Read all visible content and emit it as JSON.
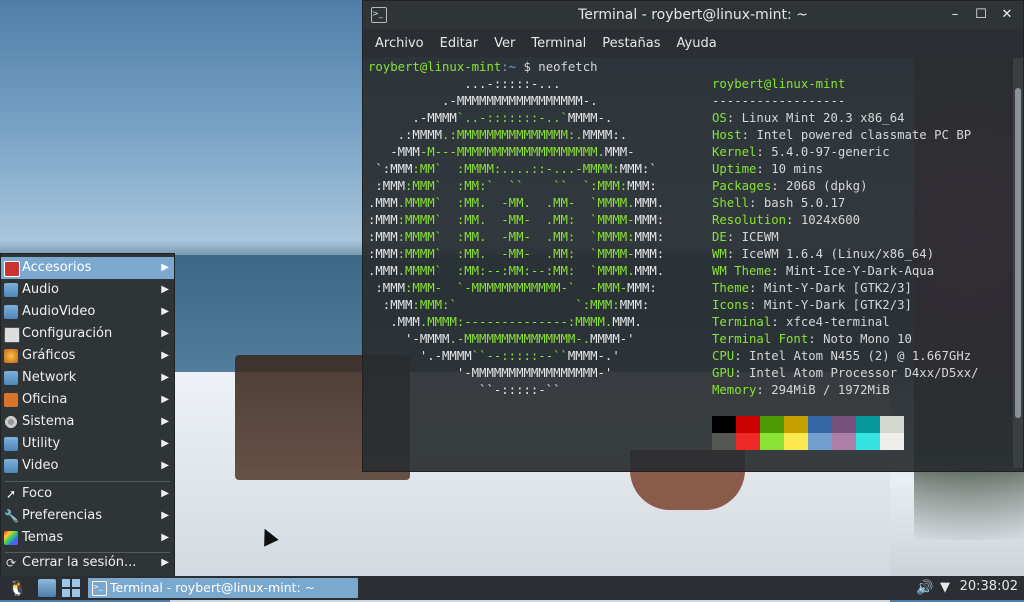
{
  "window": {
    "title": "Terminal - roybert@linux-mint: ~",
    "menu": [
      "Archivo",
      "Editar",
      "Ver",
      "Terminal",
      "Pestañas",
      "Ayuda"
    ]
  },
  "terminal": {
    "prompt_user": "roybert@linux-mint",
    "prompt_path": ":~",
    "prompt_cmd": "$ neofetch",
    "header": "roybert@linux-mint",
    "header_rule": "------------------",
    "info": [
      {
        "key": "OS",
        "value": "Linux Mint 20.3 x86_64"
      },
      {
        "key": "Host",
        "value": "Intel powered classmate PC BP"
      },
      {
        "key": "Kernel",
        "value": "5.4.0-97-generic"
      },
      {
        "key": "Uptime",
        "value": "10 mins"
      },
      {
        "key": "Packages",
        "value": "2068 (dpkg)"
      },
      {
        "key": "Shell",
        "value": "bash 5.0.17"
      },
      {
        "key": "Resolution",
        "value": "1024x600"
      },
      {
        "key": "DE",
        "value": "ICEWM"
      },
      {
        "key": "WM",
        "value": "IceWM 1.6.4 (Linux/x86_64)"
      },
      {
        "key": "WM Theme",
        "value": "Mint-Ice-Y-Dark-Aqua"
      },
      {
        "key": "Theme",
        "value": "Mint-Y-Dark [GTK2/3]"
      },
      {
        "key": "Icons",
        "value": "Mint-Y-Dark [GTK2/3]"
      },
      {
        "key": "Terminal",
        "value": "xfce4-terminal"
      },
      {
        "key": "Terminal Font",
        "value": "Noto Mono 10"
      },
      {
        "key": "CPU",
        "value": "Intel Atom N455 (2) @ 1.667GHz"
      },
      {
        "key": "GPU",
        "value": "Intel Atom Processor D4xx/D5xx/"
      },
      {
        "key": "Memory",
        "value": "294MiB / 1972MiB"
      }
    ],
    "palette_dark": [
      "#000000",
      "#cc0000",
      "#4e9a06",
      "#c4a000",
      "#3465a4",
      "#75507b",
      "#06989a",
      "#d3d7cf"
    ],
    "palette_light": [
      "#555753",
      "#ef2929",
      "#8ae234",
      "#fce94f",
      "#739fcf",
      "#ad7fa8",
      "#34e2e2",
      "#eeeeec"
    ]
  },
  "start_menu": {
    "items": [
      {
        "label": "Accesorios",
        "icon": "accessories-icon",
        "submenu": true,
        "selected": true
      },
      {
        "label": "Audio",
        "icon": "folder-icon",
        "submenu": true
      },
      {
        "label": "AudioVideo",
        "icon": "folder-icon",
        "submenu": true
      },
      {
        "label": "Configuración",
        "icon": "settings-icon",
        "submenu": true
      },
      {
        "label": "Gráficos",
        "icon": "graphics-icon",
        "submenu": true
      },
      {
        "label": "Network",
        "icon": "folder-icon",
        "submenu": true
      },
      {
        "label": "Oficina",
        "icon": "office-icon",
        "submenu": true
      },
      {
        "label": "Sistema",
        "icon": "gear-icon",
        "submenu": true
      },
      {
        "label": "Utility",
        "icon": "folder-icon",
        "submenu": true
      },
      {
        "label": "Video",
        "icon": "folder-icon",
        "submenu": true
      }
    ],
    "items2": [
      {
        "label": "Foco",
        "icon": "pointer-icon",
        "submenu": true
      },
      {
        "label": "Preferencias",
        "icon": "wrench-icon",
        "submenu": true
      },
      {
        "label": "Temas",
        "icon": "themes-icon",
        "submenu": true
      }
    ],
    "logout": "Cerrar la sesión..."
  },
  "taskbar": {
    "task_label": "Terminal - roybert@linux-mint: ~",
    "clock": "20:38:02"
  }
}
